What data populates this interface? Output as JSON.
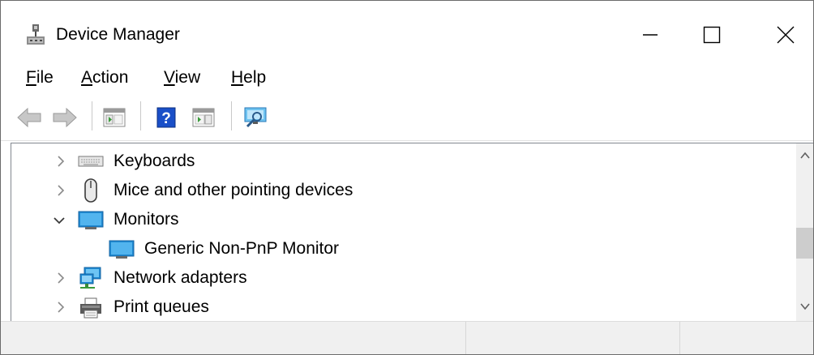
{
  "window": {
    "title": "Device Manager"
  },
  "menu": [
    {
      "label_acc": "F",
      "label_rest": "ile"
    },
    {
      "label_acc": "A",
      "label_rest": "ction"
    },
    {
      "label_acc": "V",
      "label_rest": "iew"
    },
    {
      "label_acc": "H",
      "label_rest": "elp"
    }
  ],
  "tree": [
    {
      "label": "Keyboards",
      "expanded": false,
      "icon": "keyboard-icon"
    },
    {
      "label": "Mice and other pointing devices",
      "expanded": false,
      "icon": "mouse-icon"
    },
    {
      "label": "Monitors",
      "expanded": true,
      "icon": "monitor-icon"
    },
    {
      "label": "Generic Non-PnP Monitor",
      "child": true,
      "icon": "monitor-icon"
    },
    {
      "label": "Network adapters",
      "expanded": false,
      "icon": "network-adapter-icon"
    },
    {
      "label": "Print queues",
      "expanded": false,
      "icon": "printer-icon"
    }
  ],
  "colors": {
    "accent": "#1f8ad2",
    "help": "#1a4fc8"
  }
}
